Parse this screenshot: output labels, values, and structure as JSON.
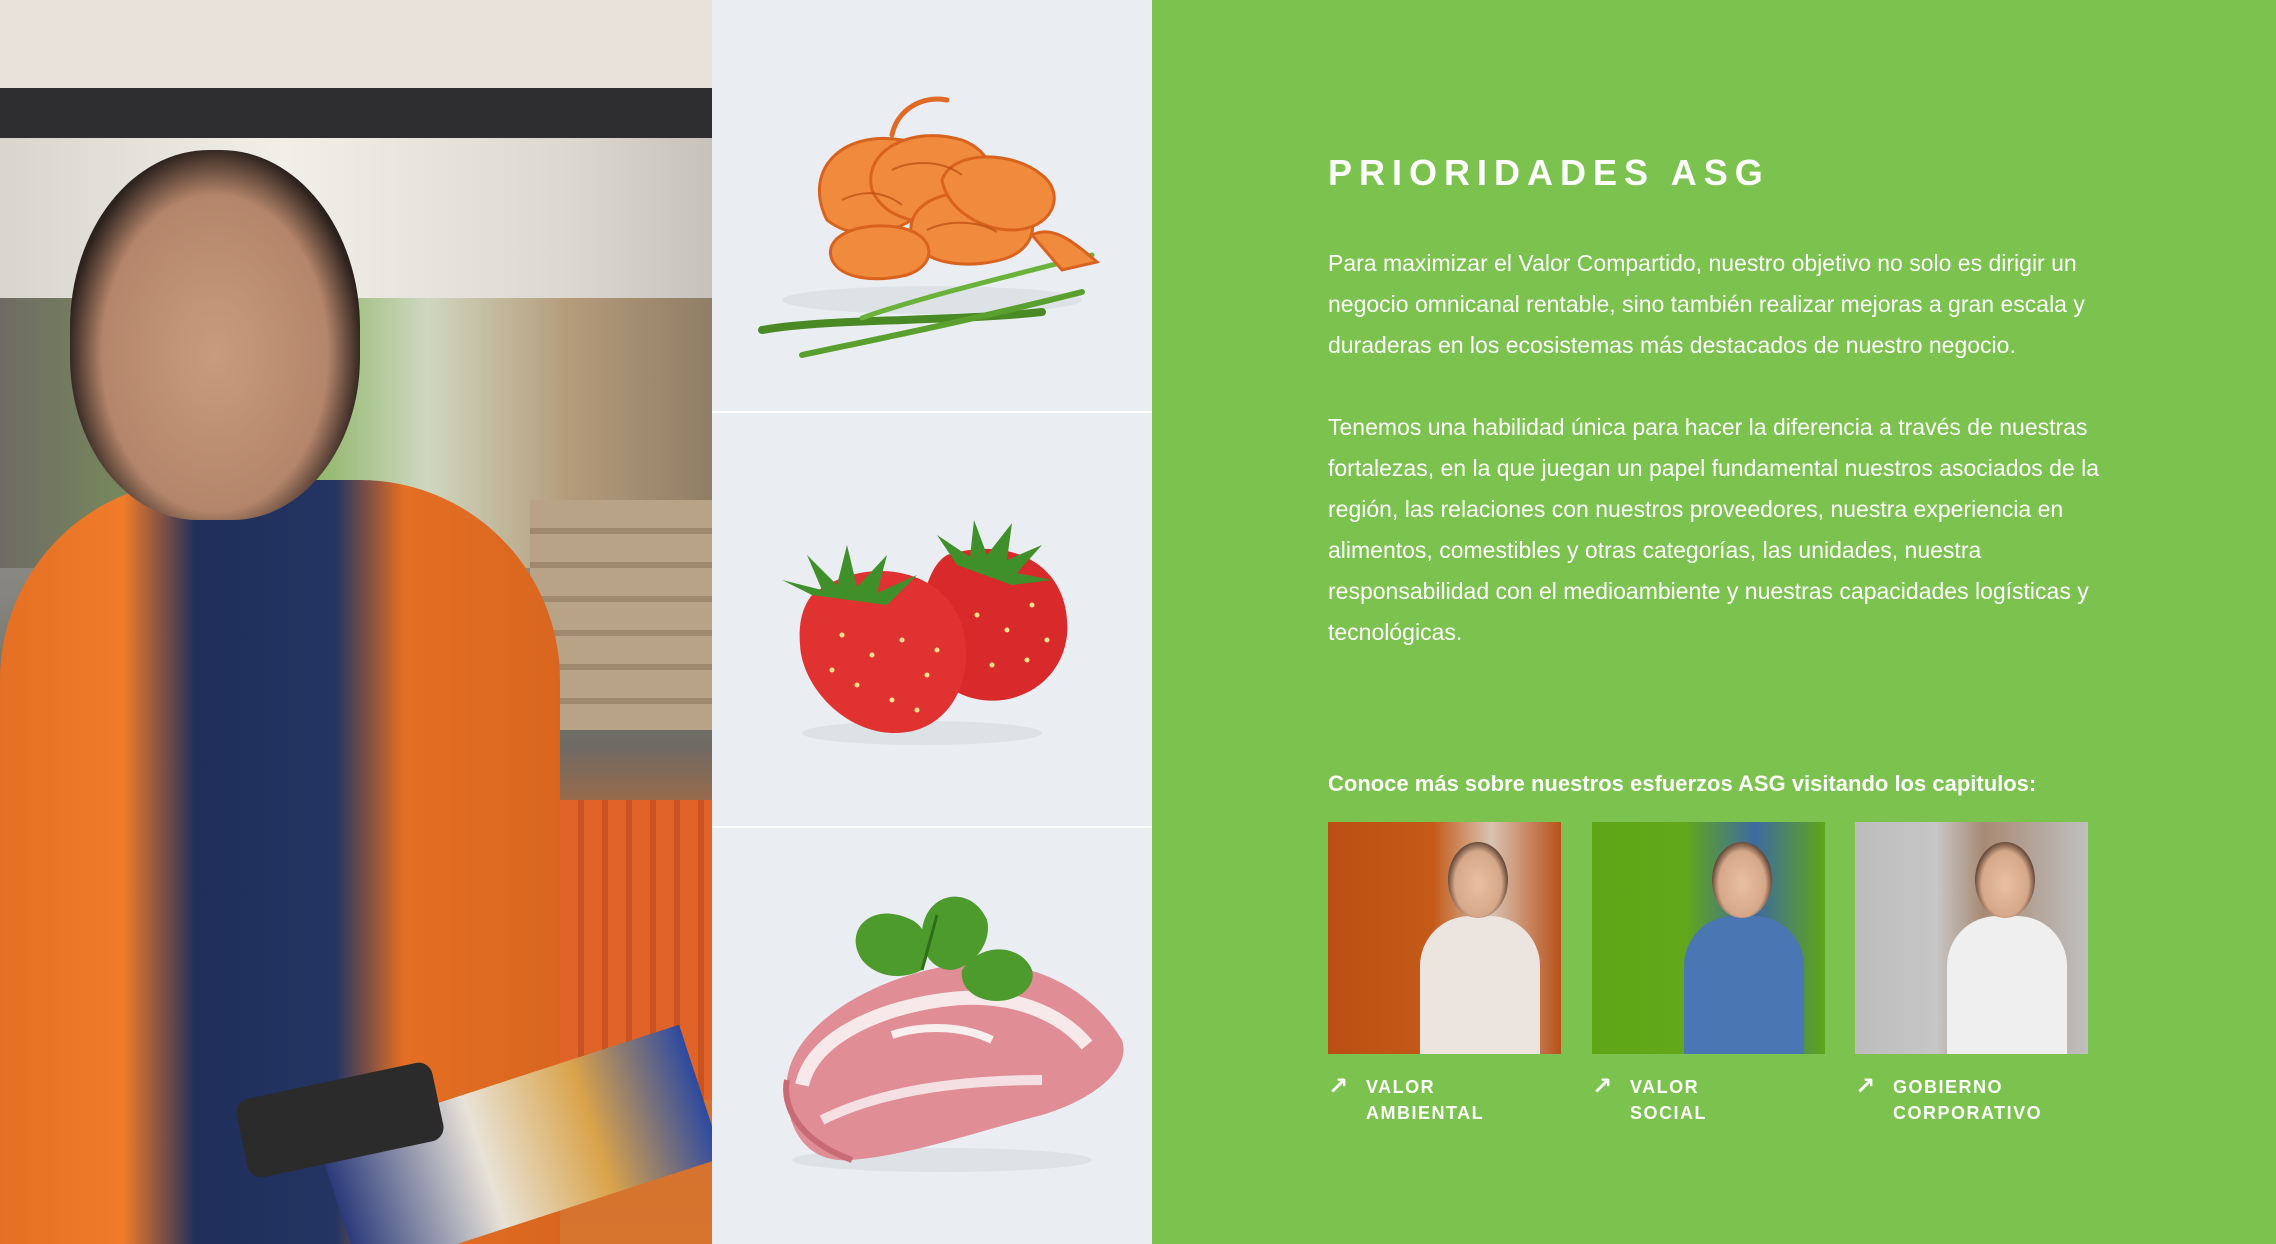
{
  "panel": {
    "title": "PRIORIDADES ASG",
    "paragraph_1": "Para maximizar el Valor Compartido, nuestro objetivo no solo es dirigir un negocio omnicanal rentable, sino también realizar mejoras a gran escala y duraderas en los ecosistemas más destacados de nuestro negocio.",
    "paragraph_2": "Tenemos una habilidad única para hacer la diferencia a través de nuestras fortalezas, en la que juegan un papel fundamental nuestros asociados de la región, las relaciones con nuestros proveedores, nuestra experiencia en alimentos, comestibles y otras categorías, las unidades, nuestra responsabilidad con el medioambiente y nuestras capacidades logísticas y tecnológicas.",
    "cta_label": "Conoce más sobre nuestros esfuerzos ASG visitando los capitulos:"
  },
  "chapters": [
    {
      "line1": "VALOR",
      "line2": "AMBIENTAL",
      "icon": "arrow-up-right-icon"
    },
    {
      "line1": "VALOR",
      "line2": "SOCIAL",
      "icon": "arrow-up-right-icon"
    },
    {
      "line1": "GOBIERNO",
      "line2": "CORPORATIVO",
      "icon": "arrow-up-right-icon"
    }
  ],
  "colors": {
    "panel_green": "#7cc24e",
    "food_bg": "#eaeef2",
    "text": "#ffffff"
  }
}
